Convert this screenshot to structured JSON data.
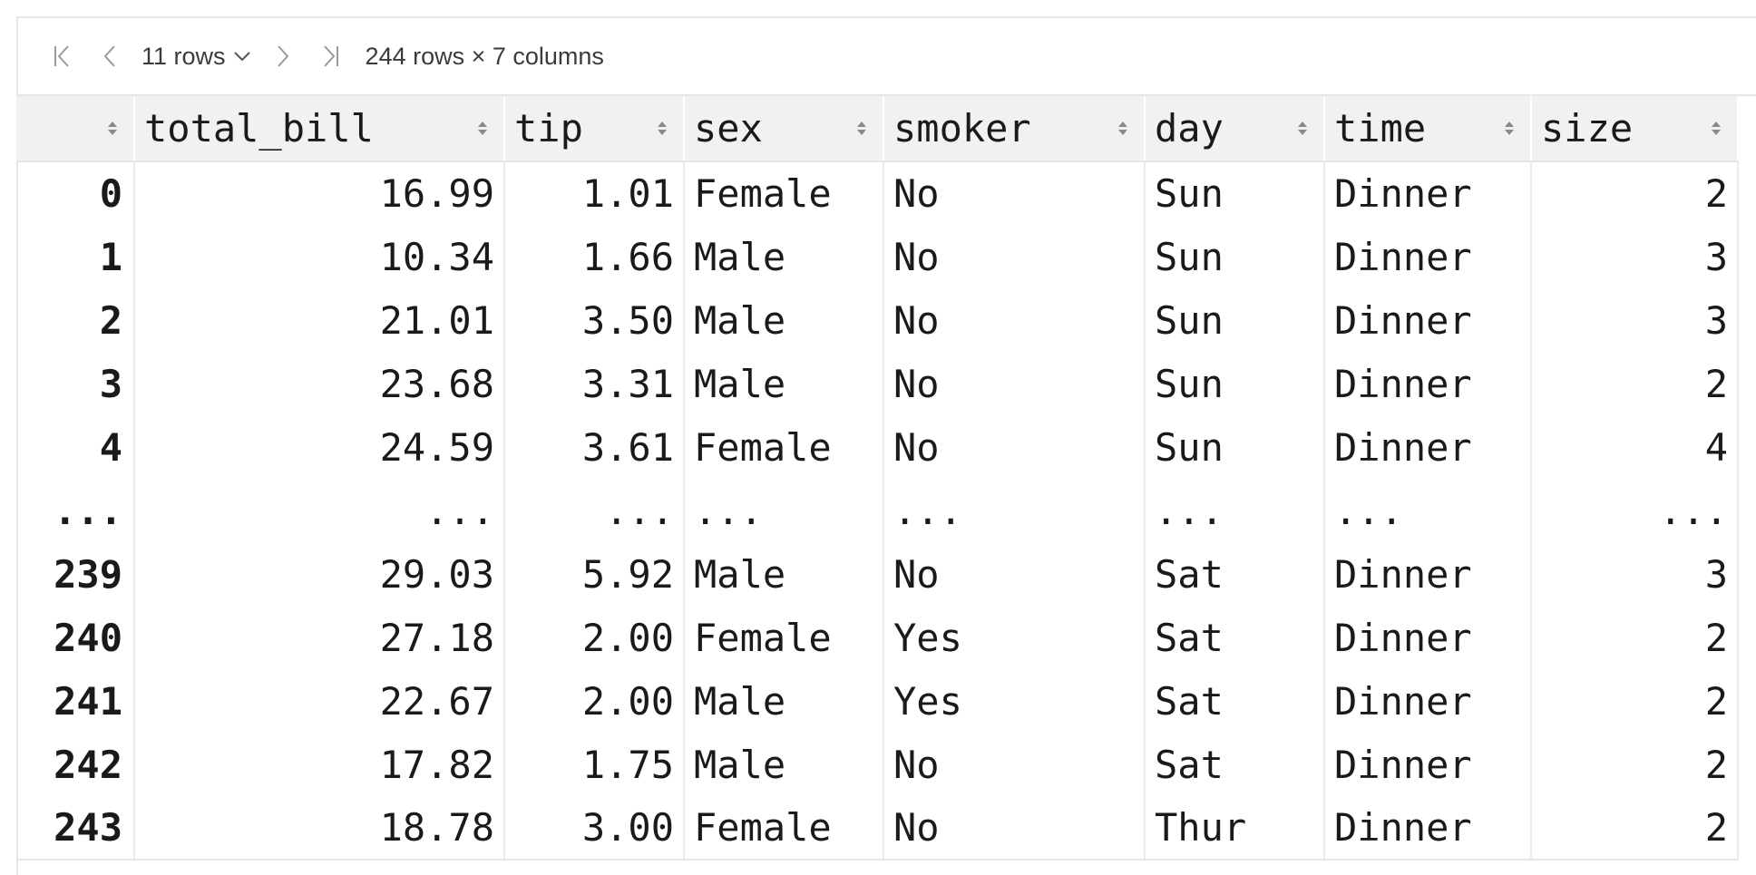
{
  "toolbar": {
    "rows_label": "11 rows",
    "summary": "244 rows × 7 columns",
    "icons": {
      "first": "first-page-icon",
      "prev": "previous-page-icon",
      "next": "next-page-icon",
      "last": "last-page-icon",
      "dropdown": "chevron-down-icon",
      "sort": "sort-icon"
    }
  },
  "table": {
    "columns": [
      "",
      "total_bill",
      "tip",
      "sex",
      "smoker",
      "day",
      "time",
      "size"
    ],
    "rows": [
      [
        "0",
        "16.99",
        "1.01",
        "Female",
        "No",
        "Sun",
        "Dinner",
        "2"
      ],
      [
        "1",
        "10.34",
        "1.66",
        "Male",
        "No",
        "Sun",
        "Dinner",
        "3"
      ],
      [
        "2",
        "21.01",
        "3.50",
        "Male",
        "No",
        "Sun",
        "Dinner",
        "3"
      ],
      [
        "3",
        "23.68",
        "3.31",
        "Male",
        "No",
        "Sun",
        "Dinner",
        "2"
      ],
      [
        "4",
        "24.59",
        "3.61",
        "Female",
        "No",
        "Sun",
        "Dinner",
        "4"
      ],
      [
        "...",
        "...",
        "...",
        "...",
        "...",
        "...",
        "...",
        "..."
      ],
      [
        "239",
        "29.03",
        "5.92",
        "Male",
        "No",
        "Sat",
        "Dinner",
        "3"
      ],
      [
        "240",
        "27.18",
        "2.00",
        "Female",
        "Yes",
        "Sat",
        "Dinner",
        "2"
      ],
      [
        "241",
        "22.67",
        "2.00",
        "Male",
        "Yes",
        "Sat",
        "Dinner",
        "2"
      ],
      [
        "242",
        "17.82",
        "1.75",
        "Male",
        "No",
        "Sat",
        "Dinner",
        "2"
      ],
      [
        "243",
        "18.78",
        "3.00",
        "Female",
        "No",
        "Thur",
        "Dinner",
        "2"
      ]
    ]
  }
}
